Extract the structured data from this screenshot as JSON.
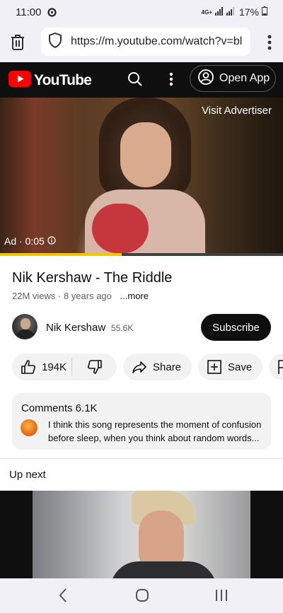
{
  "status_bar": {
    "time": "11:00",
    "network": "4G+",
    "battery": "17%"
  },
  "browser": {
    "url": "https://m.youtube.com/watch?v=bl"
  },
  "youtube_header": {
    "logo_text": "YouTube",
    "open_app_label": "Open App"
  },
  "player": {
    "visit_advertiser": "Visit Advertiser",
    "ad_label": "Ad · 0:05",
    "progress": 0.43
  },
  "video": {
    "title": "Nik Kershaw - The Riddle",
    "meta": "22M views · 8 years ago",
    "more_label": "...more"
  },
  "channel": {
    "name": "Nik Kershaw",
    "subscribers": "55.6K",
    "subscribe_label": "Subscribe"
  },
  "actions": {
    "likes": "194K",
    "share_label": "Share",
    "save_label": "Save"
  },
  "comments": {
    "title": "Comments 6.1K",
    "top_comment": "I think this song represents the moment of confusion before sleep, when you think about random words..."
  },
  "up_next": {
    "label": "Up next"
  },
  "colors": {
    "youtube_red": "#ff0000",
    "header_bg": "#0f0f0f",
    "progress_yellow": "#f7c600"
  }
}
